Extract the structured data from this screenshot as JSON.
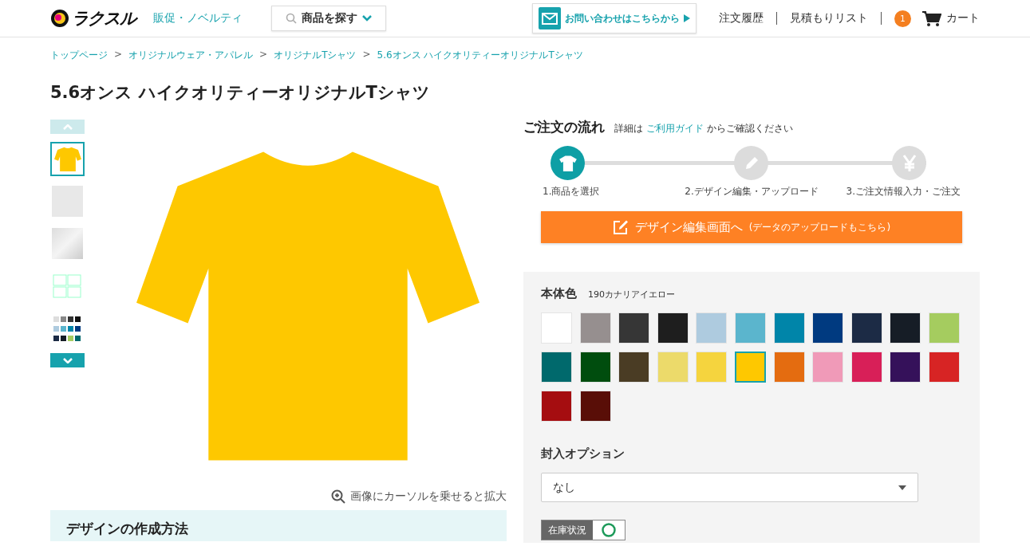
{
  "header": {
    "logo": "ラクスル",
    "category_link": "販促・ノベルティ",
    "search_menu": "商品を探す",
    "contact_button": "お問い合わせはこちらから",
    "nav": [
      {
        "label": "注文履歴"
      },
      {
        "label": "見積もりリスト"
      }
    ],
    "cart": {
      "count": "1",
      "label": "カート"
    }
  },
  "breadcrumb": [
    "トップページ",
    "オリジナルウェア・アパレル",
    "オリジナルTシャツ",
    "5.6オンス ハイクオリティーオリジナルTシャツ"
  ],
  "breadcrumb_separator": ">",
  "title": "5.6オンス ハイクオリティーオリジナルTシャツ",
  "gallery": {
    "thumbnails": [
      {
        "kind": "shirt",
        "selected": true
      },
      {
        "kind": "model",
        "selected": false
      },
      {
        "kind": "fabric",
        "selected": false
      },
      {
        "kind": "layout",
        "selected": false
      },
      {
        "kind": "colors",
        "selected": false
      }
    ],
    "zoom_hint": "画像にカーソルを乗せると拡大"
  },
  "flow": {
    "title": "ご注文の流れ",
    "note_before": "詳細は",
    "guide_link": "ご利用ガイド",
    "note_after": "からご確認ください",
    "steps": [
      {
        "label": "1.商品を選択",
        "kind": "shirt",
        "active": true
      },
      {
        "label": "2.デザイン編集・アップロード",
        "kind": "pencil",
        "active": false
      },
      {
        "label": "3.ご注文情報入力・ご注文",
        "kind": "yen",
        "active": false
      }
    ],
    "design_button": "デザイン編集画面へ",
    "design_button_note": "(データのアップロードもこちら)"
  },
  "options": {
    "color_label": "本体色",
    "color_name": "190カナリアイエロー",
    "swatches": [
      {
        "color": "#ffffff",
        "selected": false
      },
      {
        "color": "#968f8f",
        "selected": false
      },
      {
        "color": "#363636",
        "selected": false
      },
      {
        "color": "#1e1e1e",
        "selected": false
      },
      {
        "color": "#aecbdf",
        "selected": false
      },
      {
        "color": "#5bb5cd",
        "selected": false
      },
      {
        "color": "#0085a9",
        "selected": false
      },
      {
        "color": "#003a80",
        "selected": false
      },
      {
        "color": "#1c2b45",
        "selected": false
      },
      {
        "color": "#161d26",
        "selected": false
      },
      {
        "color": "#a5cc5f",
        "selected": false
      },
      {
        "color": "#00696c",
        "selected": false
      },
      {
        "color": "#004d0e",
        "selected": false
      },
      {
        "color": "#4a3c24",
        "selected": false
      },
      {
        "color": "#ecda6a",
        "selected": false
      },
      {
        "color": "#f5d43e",
        "selected": false
      },
      {
        "color": "#fec800",
        "selected": true
      },
      {
        "color": "#e46c10",
        "selected": false
      },
      {
        "color": "#f09ab8",
        "selected": false
      },
      {
        "color": "#d81f58",
        "selected": false
      },
      {
        "color": "#35115a",
        "selected": false
      },
      {
        "color": "#d72424",
        "selected": false
      },
      {
        "color": "#a50d10",
        "selected": false
      },
      {
        "color": "#590e07",
        "selected": false
      }
    ],
    "insert_label": "封入オプション",
    "insert_value": "なし",
    "stock_label": "在庫状況",
    "in_stock": true
  },
  "section_heading": "デザインの作成方法"
}
